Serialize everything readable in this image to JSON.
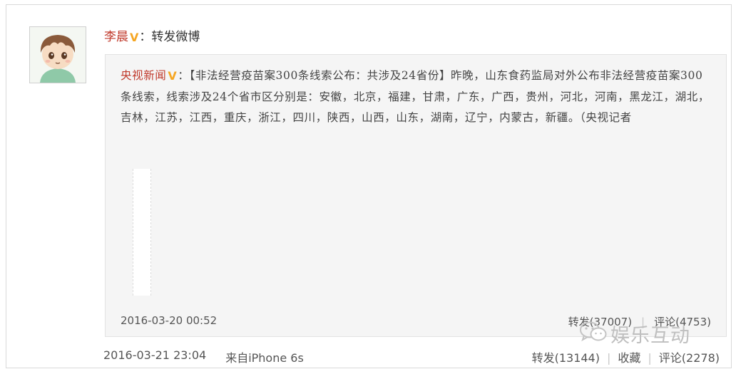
{
  "post": {
    "author": "李晨",
    "action": "：转发微博",
    "verified_badge": "V",
    "time": "2016-03-21 23:04",
    "source": "来自iPhone 6s",
    "repost_label": "转发(13144)",
    "favorite_label": "收藏",
    "comment_label": "评论(2278)"
  },
  "original": {
    "author": "央视新闻",
    "verified_badge": "V",
    "text": "：【非法经营疫苗案300条线索公布：共涉及24省份】昨晚，山东食药监局对外公布非法经营疫苗案300条线索，线索涉及24个省市区分别是：安徽，北京，福建，甘肃，广东，广西，贵州，河北，河南，黑龙江，湖北，吉林，江苏，江西，重庆，浙江，四川，陕西，山西，山东，湖南，辽宁，内蒙古，新疆。（央视记者",
    "time": "2016-03-20 00:52",
    "repost_label": "转发(37007)",
    "comment_label": "评论(4753)",
    "separator": "|"
  },
  "watermark": {
    "text": "娱乐互动",
    "icon": "wechat-icon"
  },
  "colors": {
    "name_red": "#c0392b",
    "badge_orange": "#f5a623",
    "panel_bg": "#f5f5f5"
  }
}
